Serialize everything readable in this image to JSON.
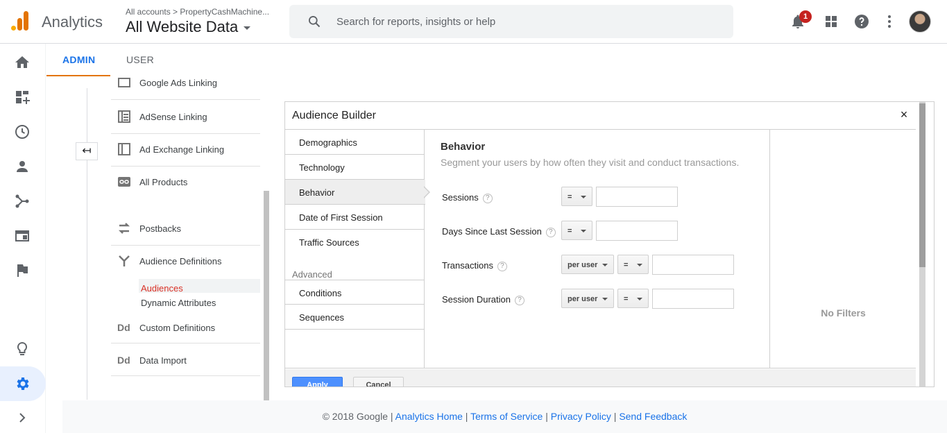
{
  "header": {
    "app_title": "Analytics",
    "account_crumb": "All accounts > PropertyCashMachine...",
    "view_name": "All Website Data",
    "search_placeholder": "Search for reports, insights or help",
    "notification_count": "1",
    "brand_colors": {
      "primary": "#e37400",
      "secondary": "#f9ab00",
      "accent": "#1a73e8"
    }
  },
  "rail": {
    "icons": [
      "home-icon",
      "customization-icon",
      "realtime-icon",
      "audience-icon",
      "acquisition-icon",
      "behavior-icon",
      "conversions-icon",
      "discover-icon",
      "admin-gear-icon",
      "expand-icon"
    ]
  },
  "tabs": {
    "admin": "ADMIN",
    "user": "USER"
  },
  "admin_nav": {
    "back_glyph": "↤",
    "items": [
      {
        "label": "Google Ads Linking"
      },
      {
        "label": "AdSense Linking"
      },
      {
        "label": "Ad Exchange Linking"
      },
      {
        "label": "All Products"
      },
      {
        "label": "Postbacks"
      },
      {
        "label": "Audience Definitions"
      },
      {
        "label": "Custom Definitions",
        "icon_text": "Dd"
      },
      {
        "label": "Data Import",
        "icon_text": "Dd"
      }
    ],
    "sub_items": [
      {
        "label": "Audiences",
        "active": true
      },
      {
        "label": "Dynamic Attributes"
      }
    ]
  },
  "dialog": {
    "title": "Audience Builder",
    "close_glyph": "×",
    "categories": [
      "Demographics",
      "Technology",
      "Behavior",
      "Date of First Session",
      "Traffic Sources"
    ],
    "advanced_label": "Advanced",
    "advanced": [
      "Conditions",
      "Sequences"
    ],
    "active_category": "Behavior",
    "section_title": "Behavior",
    "section_subtitle": "Segment your users by how often they visit and conduct transactions.",
    "help_glyph": "?",
    "filters": [
      {
        "label": "Sessions",
        "operator": "=",
        "value": ""
      },
      {
        "label": "Days Since Last Session",
        "operator": "=",
        "value": ""
      },
      {
        "label": "Transactions",
        "scope": "per user",
        "operator": "=",
        "value": ""
      },
      {
        "label": "Session Duration",
        "scope": "per user",
        "operator": "=",
        "value": ""
      }
    ],
    "summary_empty": "No Filters",
    "apply_label": "Apply",
    "cancel_label": "Cancel"
  },
  "footer": {
    "copyright": "© 2018 Google",
    "links": [
      "Analytics Home",
      "Terms of Service",
      "Privacy Policy",
      "Send Feedback"
    ],
    "separator": "|"
  }
}
